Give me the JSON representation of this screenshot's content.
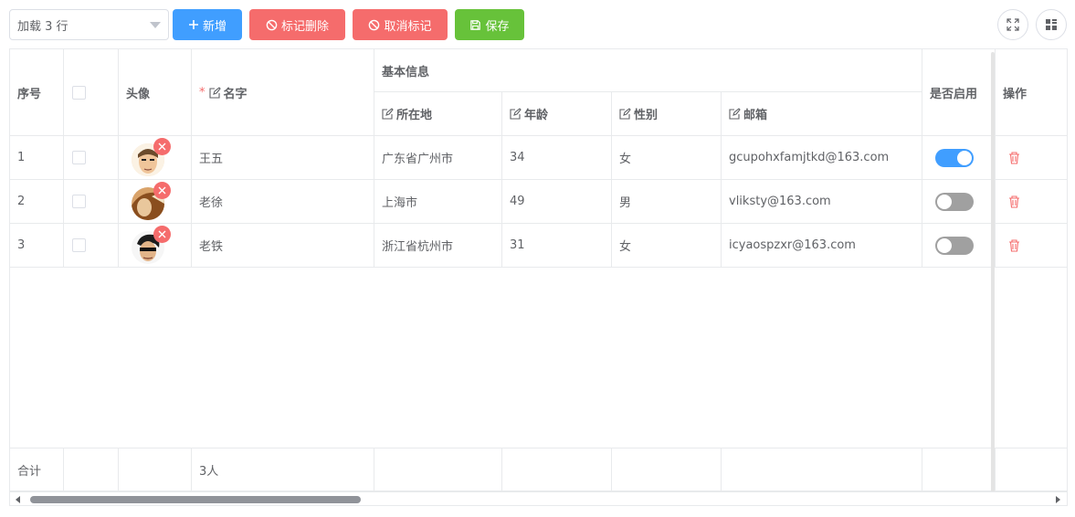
{
  "toolbar": {
    "rows_select": "加载 3 行",
    "add_label": "新增",
    "mark_delete_label": "标记删除",
    "cancel_mark_label": "取消标记",
    "save_label": "保存"
  },
  "table": {
    "headers": {
      "index": "序号",
      "avatar": "头像",
      "name": "名字",
      "group": "基本信息",
      "location": "所在地",
      "age": "年龄",
      "gender": "性别",
      "email": "邮箱",
      "enabled": "是否启用",
      "actions": "操作"
    },
    "rows": [
      {
        "index": "1",
        "name": "王五",
        "location": "广东省广州市",
        "age": "34",
        "gender": "女",
        "email": "gcupohxfamjtkd@163.com",
        "enabled": true
      },
      {
        "index": "2",
        "name": "老徐",
        "location": "上海市",
        "age": "49",
        "gender": "男",
        "email": "vliksty@163.com",
        "enabled": false
      },
      {
        "index": "3",
        "name": "老铁",
        "location": "浙江省杭州市",
        "age": "31",
        "gender": "女",
        "email": "icyaospzxr@163.com",
        "enabled": false
      }
    ],
    "footer": {
      "label": "合计",
      "name_total": "3人"
    }
  },
  "colors": {
    "primary": "#409eff",
    "danger": "#f56c6c",
    "success": "#67c23a",
    "switch_off": "#a0a0a0"
  }
}
